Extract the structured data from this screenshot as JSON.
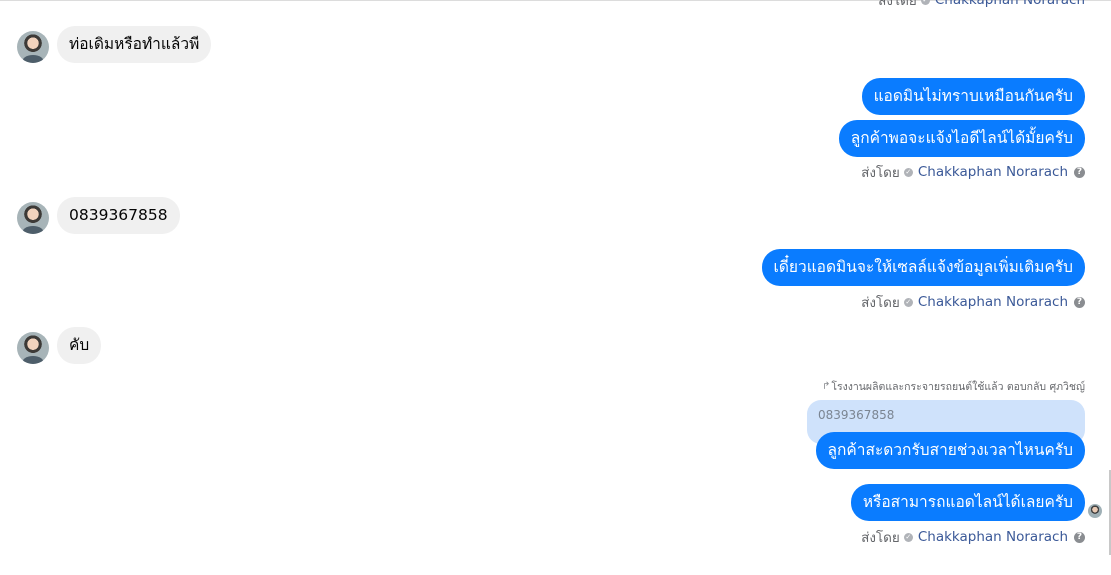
{
  "sender_name": "Chakkaphan Norarach",
  "sent_by_label": "ส่งโดย",
  "incoming": [
    {
      "text": "ท่อเดิมหรือทำแล้วพี"
    },
    {
      "text": "0839367858"
    },
    {
      "text": "คับ"
    }
  ],
  "outgoing": [
    {
      "text": "แอดมินไม่ทราบเหมือนกันครับ"
    },
    {
      "text": "ลูกค้าพอจะแจ้งไอดีไลน์ได้มั้ยครับ"
    },
    {
      "text": "เดี๋ยวแอดมินจะให้เซลล์แจ้งข้อมูลเพิ่มเติมครับ"
    },
    {
      "text": "ลูกค้าสะดวกรับสายช่วงเวลาไหนครับ"
    },
    {
      "text": "หรือสามารถแอดไลน์ได้เลยครับ"
    }
  ],
  "reply": {
    "context": "โรงงานผลิตและกระจายรถยนต์ใช้แล้ว ตอบกลับ ศุภวิชญ์",
    "quoted": "0839367858"
  },
  "colors": {
    "outgoing_bubble": "#0a7cff",
    "incoming_bubble": "#f0f0f0",
    "quoted_bubble": "#cfe2fb",
    "sender_name": "#3b5998"
  }
}
